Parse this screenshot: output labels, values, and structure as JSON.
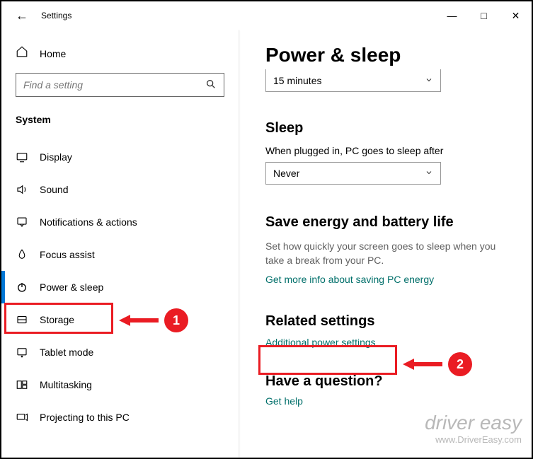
{
  "window": {
    "title": "Settings"
  },
  "sidebar": {
    "home_label": "Home",
    "search_placeholder": "Find a setting",
    "section": "System",
    "items": [
      {
        "label": "Display"
      },
      {
        "label": "Sound"
      },
      {
        "label": "Notifications & actions"
      },
      {
        "label": "Focus assist"
      },
      {
        "label": "Power & sleep"
      },
      {
        "label": "Storage"
      },
      {
        "label": "Tablet mode"
      },
      {
        "label": "Multitasking"
      },
      {
        "label": "Projecting to this PC"
      }
    ]
  },
  "main": {
    "page_title": "Power & sleep",
    "screen_dropdown_value": "15 minutes",
    "sleep_heading": "Sleep",
    "sleep_label": "When plugged in, PC goes to sleep after",
    "sleep_dropdown_value": "Never",
    "energy_heading": "Save energy and battery life",
    "energy_text": "Set how quickly your screen goes to sleep when you take a break from your PC.",
    "energy_link": "Get more info about saving PC energy",
    "related_heading": "Related settings",
    "related_link": "Additional power settings",
    "question_heading": "Have a question?",
    "help_link": "Get help"
  },
  "annotations": {
    "badge1": "1",
    "badge2": "2"
  },
  "watermark": {
    "line1": "driver easy",
    "line2": "www.DriverEasy.com"
  }
}
